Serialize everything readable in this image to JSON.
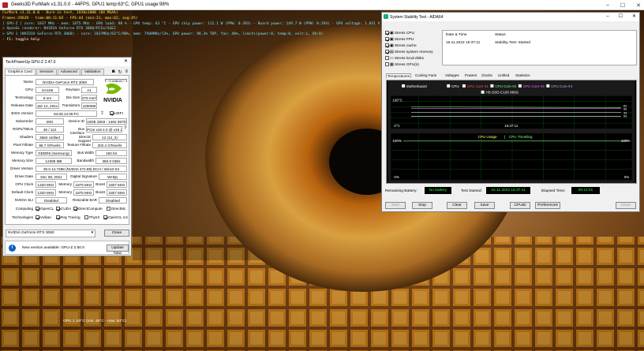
{
  "window": {
    "title": "Geeks3D FurMark v1.31.0.0 - 44FPS, GPU1 temp:63°C, GPU1 usage:98%"
  },
  "osd": {
    "line1": "FurMark v1.31.0.0 - Burn-in test, 1920x1080 (0X MSAA)",
    "line2": "Frames:29639 - time:00:11:03 - FPS:44 (min:31, max:62, avg:45)",
    "line3": "[ GPU-Z ] core: 1837 MHz - mem: 1875 MHz - GPU load: 98 % - GPU temp: 63 °C - GPU chip power: 112.1 W (PPW: 0.393) - Board power: 149.7 W (PPW: 0.294) - GPU voltage: 1.031 V",
    "line4": "> OpenGL renderer: NVIDIA GeForce RTX 3060/PCIe/SSE2",
    "line5": "> GPU 1 (NVIDIA GeForce RTX 3060) - core: 1837MHz/63°C/98%, mem: 7500MHz/13%, GPU power: 98.3% TDP, fan: 40%, limits(power:0, temp:0, volt:1, OV:0)",
    "line6": "- F1: toggle help",
    "bottom": "GPU 1: 63°C (min: 40°C - max: 63°C)"
  },
  "gpuz": {
    "title": "TechPowerUp GPU-Z 2.47.0",
    "tabs": [
      "Graphics Card",
      "Sensors",
      "Advanced",
      "Validation"
    ],
    "lookup": "Lookup",
    "uefi": "UEFI",
    "vendor_logo": "NVIDIA",
    "fields": {
      "name_l": "Name",
      "name": "NVIDIA GeForce RTX 3060",
      "gpu_l": "GPU",
      "gpu": "GA106",
      "rev_l": "Revision",
      "rev": "A1",
      "tech_l": "Technology",
      "tech": "8 nm",
      "die_l": "Die Size",
      "die": "276 mm²",
      "rel_l": "Release Date",
      "rel": "Jan 12, 2021",
      "trans_l": "Transistors",
      "trans": "12000M",
      "bios_l": "BIOS Version",
      "bios": "94.06.14.00.FC",
      "sub_l": "Subvendor",
      "sub": "MSI",
      "devid_l": "Device ID",
      "devid": "10DE 2503 - 1462 397D",
      "rops_l": "ROPs/TMUs",
      "rops": "48 / 112",
      "bus_l": "Bus Interface",
      "bus": "PCIe x16 4.0 @ x16 2.0",
      "shd_l": "Shaders",
      "shd": "3584 Unified",
      "dx_l": "DirectX Support",
      "dx": "12 (12_2)",
      "pix_l": "Pixel Fillrate",
      "pix": "86.7 GPixel/s",
      "tex_l": "Texture Fillrate",
      "tex": "202.4 GTexel/s",
      "memt_l": "Memory Type",
      "memt": "GDDR6 (Samsung)",
      "bw_l": "Bus Width",
      "bw": "192 bit",
      "mems_l": "Memory Size",
      "mems": "12288 MB",
      "bandw_l": "Bandwidth",
      "bandw": "360.0 GB/s",
      "drv_l": "Driver Version",
      "drv": "30.0.14.7288 (NVIDIA 472.88) DCH / Win10 64",
      "drvd_l": "Driver Date",
      "drvd": "Dec 08, 2021",
      "sig_l": "Digital Signature",
      "sig": "WHQL",
      "gclk_l": "GPU Clock",
      "gclk": "1320 MHz",
      "mem_l": "Memory",
      "gmem": "1875 MHz",
      "boost_l": "Boost",
      "gboost": "1807 MHz",
      "dclk_l": "Default Clock",
      "dclk": "1320 MHz",
      "dmem": "1875 MHz",
      "dboost": "1807 MHz",
      "sli_l": "NVIDIA SLI",
      "sli": "Disabled",
      "rbar_l": "Resizable BAR",
      "rbar": "Disabled",
      "comp_l": "Computing",
      "tech2_l": "Technologies"
    },
    "computing": [
      "OpenCL",
      "CUDA",
      "DirectCompute",
      "DirectML"
    ],
    "technologies": [
      "Vulkan",
      "Ray Tracing",
      "PhysX",
      "OpenGL 4.6"
    ],
    "select": "NVIDIA GeForce RTX 3060",
    "close": "Close",
    "notice": "New version available: GPU-Z 2.50.0",
    "update": "Update Now"
  },
  "aida": {
    "title": "System Stability Test - AIDA64",
    "stress": [
      {
        "label": "Stress CPU",
        "on": true
      },
      {
        "label": "Stress FPU",
        "on": true
      },
      {
        "label": "Stress cache",
        "on": true
      },
      {
        "label": "Stress system memory",
        "on": true
      },
      {
        "label": "Stress local disks",
        "on": false
      },
      {
        "label": "Stress GPU(s)",
        "on": false
      }
    ],
    "status_h1": "Date & Time",
    "status_h2": "Status",
    "status_date": "16.11.2022 15:37:11",
    "status_text": "Stability Test: Started",
    "tabs": [
      "Temperatures",
      "Cooling Fans",
      "Voltages",
      "Powers",
      "Clocks",
      "Unified",
      "Statistics"
    ],
    "legend": [
      "Motherboard",
      "CPU",
      "CPU Core #1",
      "CPU Core #2",
      "CPU Core #3",
      "CPU Core #4",
      "HS-SSD-C100 960G"
    ],
    "legend_colors": [
      "#ffffff",
      "#ffffff",
      "#ff5050",
      "#7cff7c",
      "#ff60ff",
      "#b0b0ff",
      "#ffffff"
    ],
    "temp_top": "100°C",
    "temp_bot": "0°C",
    "temp_time": "15:37:11",
    "temp_vals": [
      "62",
      "59",
      "34",
      "54"
    ],
    "cpu_title": "CPU Usage",
    "cpu_sep": "|",
    "cpu_throttle": "CPU Throttling",
    "cpu_top": "100%",
    "cpu_bot": "0%",
    "cpu_r_top": "100%",
    "cpu_r_bot": "0%",
    "battery_l": "Remaining Battery:",
    "battery": "No battery",
    "started_l": "Test Started:",
    "started": "16.11.2022 15:37:11",
    "elapsed_l": "Elapsed Time:",
    "elapsed": "00:12:01",
    "buttons": [
      "Start",
      "Stop",
      "Clear",
      "Save",
      "CPUID",
      "Preferences",
      "Close"
    ]
  }
}
